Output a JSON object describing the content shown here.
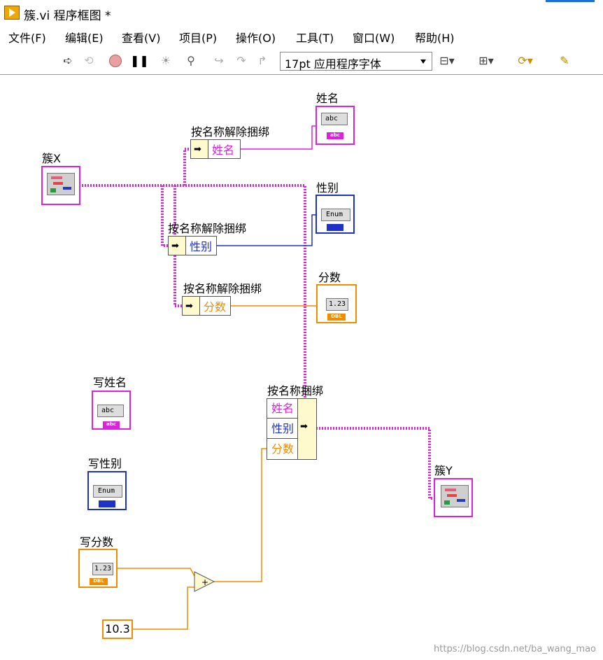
{
  "window": {
    "title": "簇.vi 程序框图 *"
  },
  "menu": [
    "文件(F)",
    "编辑(E)",
    "查看(V)",
    "项目(P)",
    "操作(O)",
    "工具(T)",
    "窗口(W)",
    "帮助(H)"
  ],
  "toolbar": {
    "font_select": "17pt 应用程序字体",
    "icons": [
      "run-arrow-icon",
      "run-continuous-icon",
      "abort-icon",
      "pause-icon",
      "highlight-bulb-icon",
      "retain-wire-values-icon",
      "step-into-icon",
      "step-over-icon",
      "step-out-icon",
      "align-objects-icon",
      "distribute-objects-icon",
      "reorder-icon",
      "cleanup-diagram-icon"
    ]
  },
  "colors": {
    "cluster_wire": "#e020e0",
    "enum_wire": "#1f32c8",
    "dbl_wire": "#f08c00",
    "string_wire": "#e020e0"
  },
  "diagram": {
    "cluster_in": {
      "label": "簇X"
    },
    "unbundle_name": {
      "label": "按名称解除捆绑",
      "field": "姓名"
    },
    "unbundle_sex": {
      "label": "按名称解除捆绑",
      "field": "性别"
    },
    "unbundle_score": {
      "label": "按名称解除捆绑",
      "field": "分数"
    },
    "ind_name": {
      "label": "姓名",
      "type_text": "abc",
      "footer": "abc"
    },
    "ind_sex": {
      "label": "性别",
      "type_text": "Enum"
    },
    "ind_score": {
      "label": "分数",
      "type_text": "1.23",
      "footer": "DBL"
    },
    "ctrl_name": {
      "label": "写姓名",
      "type_text": "abc",
      "footer": "abc"
    },
    "ctrl_sex": {
      "label": "写性别",
      "type_text": "Enum"
    },
    "ctrl_score": {
      "label": "写分数",
      "type_text": "1.23",
      "footer": "DBL"
    },
    "bundle": {
      "label": "按名称捆绑",
      "fields": [
        "姓名",
        "性别",
        "分数"
      ]
    },
    "cluster_out": {
      "label": "簇Y"
    },
    "add_node": {
      "symbol": "+"
    },
    "constant": {
      "value": "10.3"
    }
  },
  "watermark": "https://blog.csdn.net/ba_wang_mao"
}
